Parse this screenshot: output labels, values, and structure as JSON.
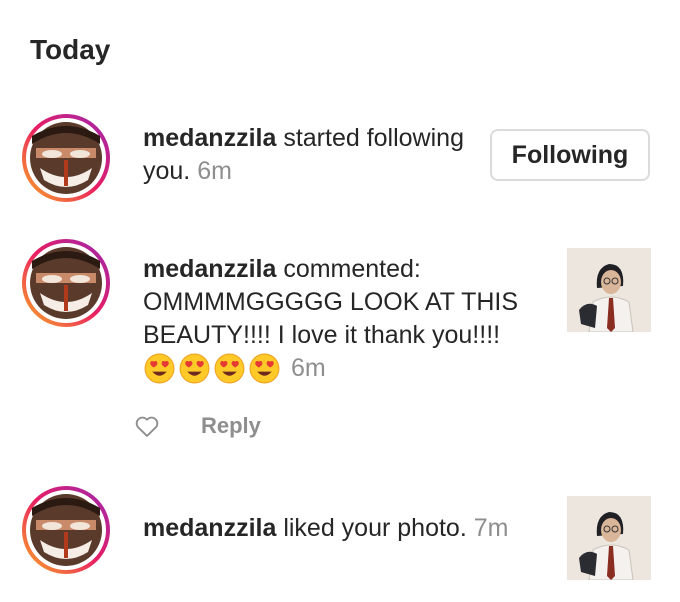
{
  "section": {
    "title": "Today"
  },
  "notifications": [
    {
      "username": "medanzzila",
      "action": " started following you.",
      "time": "6m",
      "button_label": "Following"
    },
    {
      "username": "medanzzila",
      "action": " commented: OMMMMGGGGG LOOK AT THIS BEAUTY!!!! I love it thank you!!!!",
      "line1": " commented:",
      "line2": "OMMMMGGGGG LOOK AT THIS",
      "line3": "BEAUTY!!!! I love it thank you!!!!",
      "emojis": [
        "heart-eyes-emoji",
        "heart-eyes-emoji",
        "heart-eyes-emoji",
        "heart-eyes-emoji"
      ],
      "time": "6m",
      "reply_label": "Reply"
    },
    {
      "username": "medanzzila",
      "action": " liked your photo.",
      "time": "7m"
    }
  ],
  "colors": {
    "ring_start": "#f9a825",
    "ring_end": "#c2185b",
    "muted_text": "#8e8e8e",
    "button_border": "#dbdbdb"
  }
}
